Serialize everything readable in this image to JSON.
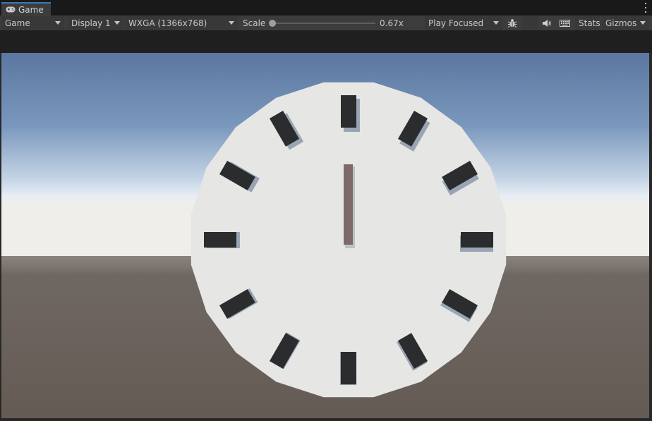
{
  "tab": {
    "label": "Game",
    "icon": "gamepad-icon"
  },
  "toolbar": {
    "view_mode": "Game",
    "display": "Display 1",
    "resolution": "WXGA (1366x768)",
    "scale_label": "Scale",
    "scale_value": "0.67x",
    "play_mode": "Play Focused",
    "stats_label": "Stats",
    "gizmos_label": "Gizmos"
  },
  "scene": {
    "clock_face_color": "#e6e6e4",
    "marker_color": "#2b2c2e",
    "hand_color": "#7d6a68",
    "sky_top": "#5c79a3",
    "sky_horizon": "#e8eef5",
    "ground_color": "#6b625d"
  }
}
